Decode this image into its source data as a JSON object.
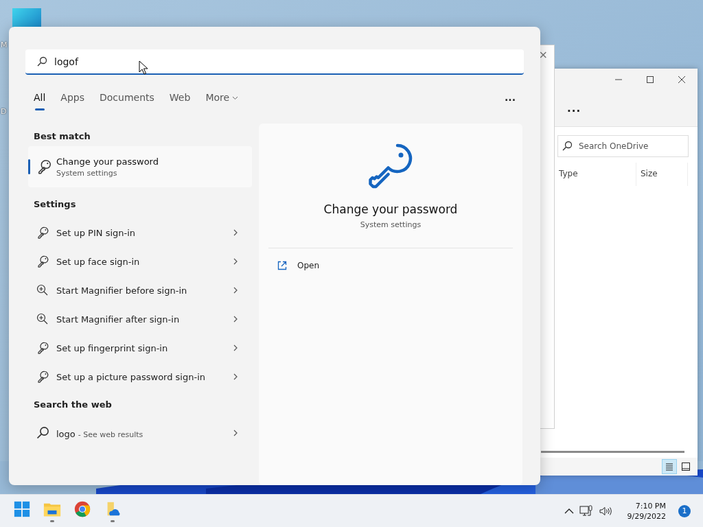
{
  "desktop": {
    "icon_labels": [
      "M",
      "D"
    ]
  },
  "back_window": {
    "close_button": "×"
  },
  "explorer_window": {
    "more_button": "...",
    "search": {
      "placeholder": "Search OneDrive"
    },
    "columns": [
      "Type",
      "Size"
    ],
    "view_buttons": [
      {
        "kind": "details",
        "selected": true
      },
      {
        "kind": "tiles",
        "selected": false
      }
    ]
  },
  "search_panel": {
    "query": "logof",
    "tabs": [
      {
        "label": "All",
        "selected": true,
        "has_menu": false
      },
      {
        "label": "Apps",
        "selected": false,
        "has_menu": false
      },
      {
        "label": "Documents",
        "selected": false,
        "has_menu": false
      },
      {
        "label": "Web",
        "selected": false,
        "has_menu": false
      },
      {
        "label": "More",
        "selected": false,
        "has_menu": true
      }
    ],
    "more_options": "...",
    "best_match": {
      "heading": "Best match",
      "title": "Change your password",
      "subtitle": "System settings",
      "selected": true
    },
    "settings": {
      "heading": "Settings",
      "items": [
        {
          "label": "Set up PIN sign-in",
          "kind": "key"
        },
        {
          "label": "Set up face sign-in",
          "kind": "key"
        },
        {
          "label": "Start Magnifier before sign-in",
          "kind": "magnifier"
        },
        {
          "label": "Start Magnifier after sign-in",
          "kind": "magnifier"
        },
        {
          "label": "Set up fingerprint sign-in",
          "kind": "key"
        },
        {
          "label": "Set up a picture password sign-in",
          "kind": "key"
        }
      ]
    },
    "web": {
      "heading": "Search the web",
      "query": "logo",
      "hint": "- See web results"
    },
    "preview": {
      "title": "Change your password",
      "subtitle": "System settings",
      "actions": [
        {
          "label": "Open"
        }
      ]
    }
  },
  "taskbar": {
    "apps": [
      {
        "kind": "start",
        "running": false
      },
      {
        "kind": "explorer",
        "running": true
      },
      {
        "kind": "browser",
        "running": false
      },
      {
        "kind": "onedrive",
        "running": true
      }
    ],
    "time": "7:10 PM",
    "date": "9/29/2022",
    "notification_count": "1"
  }
}
